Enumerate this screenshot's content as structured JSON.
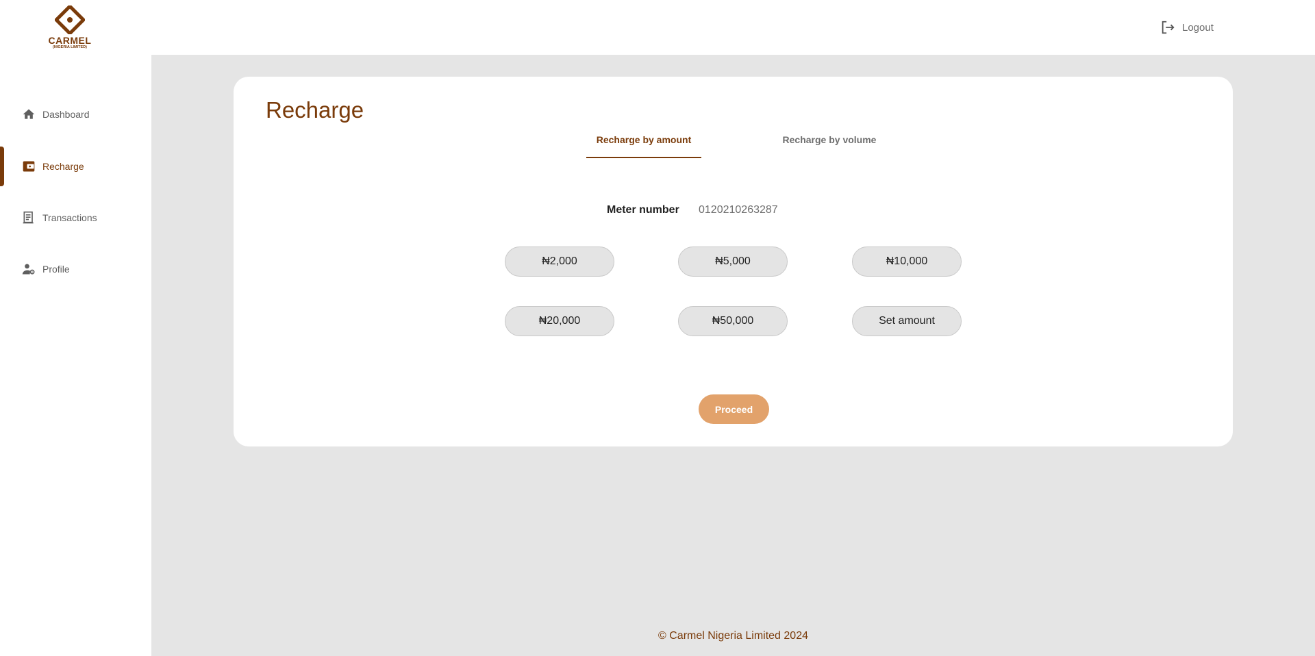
{
  "brand": {
    "name": "CARMEL",
    "subtitle": "(NIGERIA LIMITED)",
    "color": "#7a3b0a"
  },
  "header": {
    "logout_label": "Logout"
  },
  "sidebar": {
    "items": [
      {
        "label": "Dashboard",
        "icon": "home-icon",
        "active": false
      },
      {
        "label": "Recharge",
        "icon": "wallet-icon",
        "active": true
      },
      {
        "label": "Transactions",
        "icon": "receipt-icon",
        "active": false
      },
      {
        "label": "Profile",
        "icon": "user-gear-icon",
        "active": false
      }
    ]
  },
  "main": {
    "title": "Recharge",
    "tabs": [
      {
        "label": "Recharge by amount",
        "active": true
      },
      {
        "label": "Recharge by volume",
        "active": false
      }
    ],
    "meter": {
      "label": "Meter number",
      "value": "0120210263287"
    },
    "amounts": [
      "₦2,000",
      "₦5,000",
      "₦10,000",
      "₦20,000",
      "₦50,000",
      "Set amount"
    ],
    "proceed_label": "Proceed",
    "proceed_color": "#e2a26b"
  },
  "footer": {
    "text": "© Carmel Nigeria Limited 2024"
  },
  "colors": {
    "background": "#e5e5e5",
    "card": "#ffffff",
    "accent": "#7a3b0a"
  }
}
